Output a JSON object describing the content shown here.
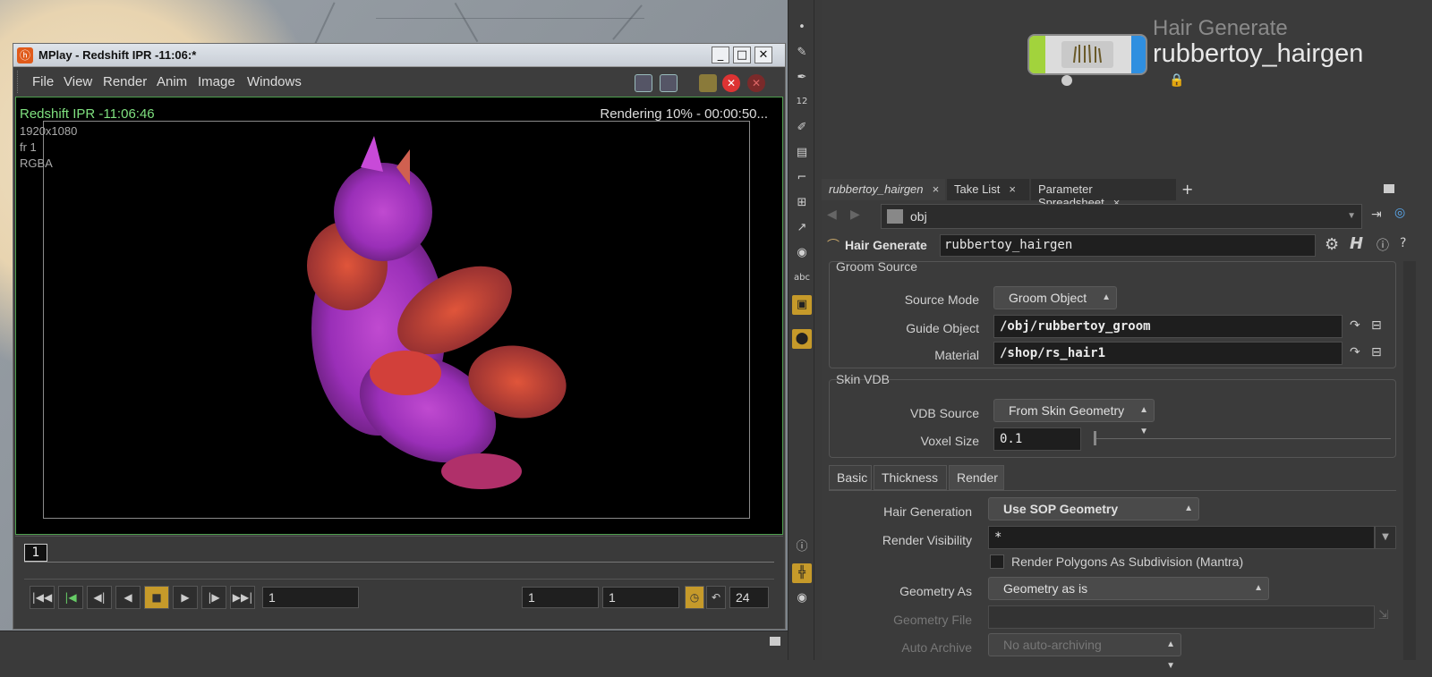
{
  "mplay": {
    "title": "MPlay - Redshift IPR -11:06:*",
    "menu": [
      "File",
      "View",
      "Render",
      "Anim",
      "Image",
      "Windows"
    ],
    "overlay": {
      "session": "Redshift IPR -11:06:46",
      "resolution": "1920x1080",
      "frame": "fr 1",
      "channels": "RGBA",
      "status": "Rendering 10% - 00:00:50..."
    },
    "timeline": {
      "frame_marker": "1",
      "current_frame": "1",
      "range_start": "1",
      "range_end": "1",
      "fps": "24"
    }
  },
  "vtoolbar": {
    "abc_label": "abc",
    "twelve_label": "12"
  },
  "network": {
    "node_type": "Hair Generate",
    "node_name": "rubbertoy_hairgen"
  },
  "params": {
    "tabs": [
      "rubbertoy_hairgen",
      "Take List",
      "Parameter Spreadsheet"
    ],
    "add_tab": "+",
    "path": "obj",
    "node_type_label": "Hair Generate",
    "node_name": "rubbertoy_hairgen",
    "groom_source": {
      "title": "Groom Source",
      "source_mode_label": "Source Mode",
      "source_mode_value": "Groom Object",
      "guide_object_label": "Guide Object",
      "guide_object_value": "/obj/rubbertoy_groom",
      "material_label": "Material",
      "material_value": "/shop/rs_hair1"
    },
    "skin_vdb": {
      "title": "Skin VDB",
      "vdb_source_label": "VDB Source",
      "vdb_source_value": "From Skin Geometry",
      "voxel_size_label": "Voxel Size",
      "voxel_size_value": "0.1"
    },
    "sub_tabs": [
      "Basic",
      "Thickness",
      "Render"
    ],
    "render": {
      "hair_generation_label": "Hair Generation",
      "hair_generation_value": "Use SOP Geometry",
      "render_visibility_label": "Render Visibility",
      "render_visibility_value": "*",
      "render_polys_label": "Render Polygons As Subdivision (Mantra)",
      "geometry_as_label": "Geometry As",
      "geometry_as_value": "Geometry as is",
      "geometry_file_label": "Geometry File",
      "auto_archive_label": "Auto Archive",
      "auto_archive_value": "No auto-archiving"
    }
  }
}
